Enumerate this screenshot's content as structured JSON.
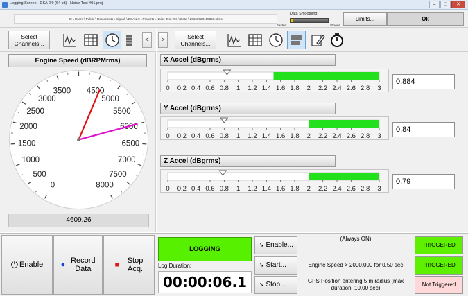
{
  "window": {
    "title": "Logging Screen - DSA 2.9 (64 bit) - Noise Test #01.proj",
    "controls": [
      "–",
      "□",
      "✕"
    ]
  },
  "info": {
    "path": "C: \\ Users \\ Public \\ Documents \\ Signalt \\ DSA 2.9 \\ Projects \\ Noise Test #01 \\ Data \\ 20160628155858.tdms",
    "smoothing_label": "Data Smoothing",
    "smoothing_fraction": 0.08,
    "faster_label": "Faster",
    "slower_label": "Slower",
    "limits_label": "Limits...",
    "ok_label": "Ok"
  },
  "toolbar_left": {
    "select_label": "Select\nChannels...",
    "arrow_label": "<",
    "icons": [
      "waveform-icon",
      "table-icon",
      "gauge-icon",
      "meter-icon"
    ]
  },
  "toolbar_right": {
    "select_label": "Select\nChannels...",
    "arrow_label": ">",
    "icons": [
      "waveform-icon",
      "table-icon",
      "gauge-icon",
      "hbar-icon",
      "edit-icon",
      "stopwatch-icon"
    ]
  },
  "gauge": {
    "title": "Engine Speed (dBRPMrms)",
    "ticks": [
      "0",
      "500",
      "1000",
      "1500",
      "2000",
      "2500",
      "3000",
      "3500",
      "4500",
      "5000",
      "5500",
      "6000",
      "6500",
      "7000",
      "7500",
      "8000"
    ],
    "value": 4609.26,
    "value_text": "4609.26",
    "secondary_value": 6000,
    "min": 0,
    "max": 8000
  },
  "meters": [
    {
      "title": "X Accel (dBgrms)",
      "value_text": "0.884",
      "value": 0.884,
      "marker": 0.84,
      "bar_start": 1.5,
      "bar_end": 3.0
    },
    {
      "title": "Y Accel (dBgrms)",
      "value_text": "0.84",
      "value": 0.84,
      "marker": 0.8,
      "bar_start": 2.0,
      "bar_end": 3.0
    },
    {
      "title": "Z Accel (dBgrms)",
      "value_text": "0.79",
      "value": 0.79,
      "marker": 0.78,
      "bar_start": 2.0,
      "bar_end": 3.0
    }
  ],
  "meter_scale": [
    "0",
    "0.2",
    "0.4",
    "0.6",
    "0.8",
    "1",
    "1.2",
    "1.4",
    "1.6",
    "1.8",
    "2",
    "2.2",
    "2.4",
    "2.6",
    "2.8",
    "3"
  ],
  "bottom": {
    "enable_label": "Enable",
    "record_label": "Record\nData",
    "stop_label": "Stop\nAcq.",
    "logging_label": "LOGGING",
    "log_duration_label": "Log Duration:",
    "timer": "00:00:06.1",
    "triggers": [
      {
        "button": "Enable...",
        "condition": "(Always ON)",
        "status": "TRIGGERED"
      },
      {
        "button": "Start...",
        "condition": "Engine Speed > 2000.000 for 0.50 sec",
        "status": "TRIGGERED"
      },
      {
        "button": "Stop...",
        "condition": "GPS Position entering 5 m radius (max duration: 10.00 sec)",
        "status": "Not Triggered"
      }
    ]
  },
  "colors": {
    "green_bar": "#22e11c",
    "needle_red": "#e01010",
    "needle_magenta": "#e010d0",
    "logging_green": "#56f000",
    "triggered_green": "#5ef000",
    "not_triggered": "#ffd9d9"
  }
}
